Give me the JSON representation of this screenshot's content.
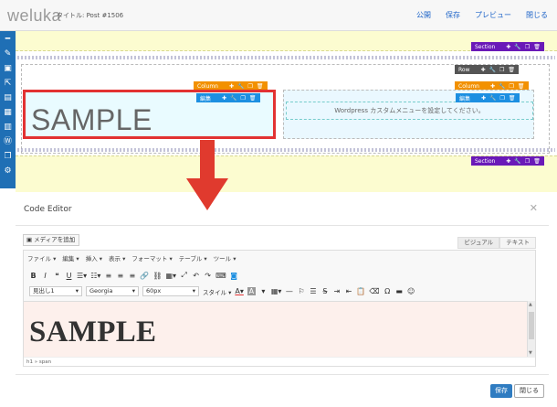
{
  "app": {
    "logo": "weluka",
    "doc_title": "タイトル: Post #1506"
  },
  "top_links": [
    "公開",
    "保存",
    "プレビュー",
    "閉じる"
  ],
  "builder": {
    "section_label": "Section",
    "row_label": "Row",
    "column_label": "Column",
    "edit_label": "編集",
    "sample_text": "SAMPLE",
    "menu_placeholder": "Wordpress カスタムメニューを設定してください。"
  },
  "editor": {
    "title": "Code Editor",
    "add_media": "メディアを追加",
    "tab_visual": "ビジュアル",
    "tab_text": "テキスト",
    "menu": [
      "ファイル ▾",
      "編集 ▾",
      "挿入 ▾",
      "表示 ▾",
      "フォーマット ▾",
      "テーブル ▾",
      "ツール ▾"
    ],
    "block_format": "見出し1",
    "font_family": "Georgia",
    "font_size": "60px",
    "style_label": "スタイル",
    "content_text": "SAMPLE",
    "status_path": "h1 » span",
    "save": "保存",
    "close": "閉じる"
  },
  "colors": {
    "section_bar": "#6a19b8",
    "column_bar": "#f29100",
    "edit_bar": "#1c8fe1",
    "highlight": "#e23232",
    "primary": "#2f7cc1"
  }
}
